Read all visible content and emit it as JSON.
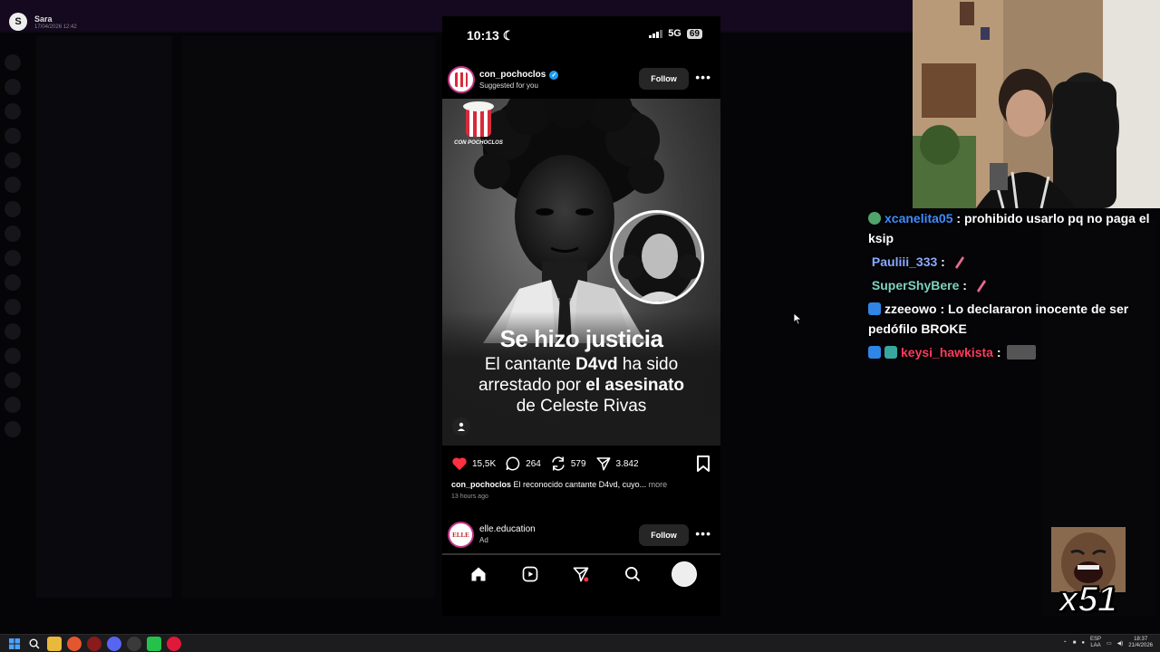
{
  "notification": {
    "name": "Sara",
    "date": "17/04/2026 12:42",
    "avatar_initial": "S"
  },
  "phone": {
    "status": {
      "time": "10:13",
      "network": "5G",
      "battery": "69"
    },
    "post": {
      "username": "con_pochoclos",
      "subtitle": "Suggested for you",
      "follow_label": "Follow",
      "brand_label": "CON POCHOCLOS",
      "headline": "Se hizo justicia",
      "body_line1_pre": "El cantante ",
      "body_line1_bold": "D4vd",
      "body_line1_post": " ha sido",
      "body_line2_pre": "arrestado por ",
      "body_line2_bold": "el asesinato",
      "body_line3": "de Celeste Rivas",
      "likes": "15,5K",
      "comments": "264",
      "reposts": "579",
      "shares": "3.842",
      "caption_user": "con_pochoclos",
      "caption_text": " El reconocido cantante D4vd, cuyo... ",
      "caption_more": "more",
      "time_ago": "13 hours ago"
    },
    "post2": {
      "username": "elle.education",
      "subtitle": "Ad",
      "follow_label": "Follow",
      "avatar_text": "ELLE"
    },
    "nav": [
      "home-icon",
      "reels-icon",
      "direct-icon",
      "search-icon",
      "profile-avatar"
    ]
  },
  "chat": [
    {
      "user": "xcanelita05",
      "color": "#3f8cff",
      "badge": "#52a36b",
      "text": "prohibido usarlo pq no paga el ksip"
    },
    {
      "user": "Pauliii_333",
      "color": "#8aa8ff",
      "badge": "",
      "text": "",
      "emote": true
    },
    {
      "user": "SuperShyBere",
      "color": "#7dd3c0",
      "badge": "",
      "text": "",
      "emote": true
    },
    {
      "user": "zzeeowo",
      "color": "#ffffff",
      "badge": "#2f86e6",
      "text": "Lo declararon inocente de ser pedófilo BROKE"
    },
    {
      "user": "keysi_hawkista",
      "color": "#ff3a5c",
      "badge": "#2f86e6",
      "text": "",
      "emote_image": true
    }
  ],
  "overlay": {
    "counter": "x51"
  },
  "taskbar": {
    "lang_top": "ESP",
    "lang_bottom": "LAA",
    "time": "18:37",
    "date": "21/4/2026"
  },
  "colors": {
    "accent_like": "#ff3040",
    "verified": "#1d9bf0",
    "follow_bg": "#262626"
  }
}
